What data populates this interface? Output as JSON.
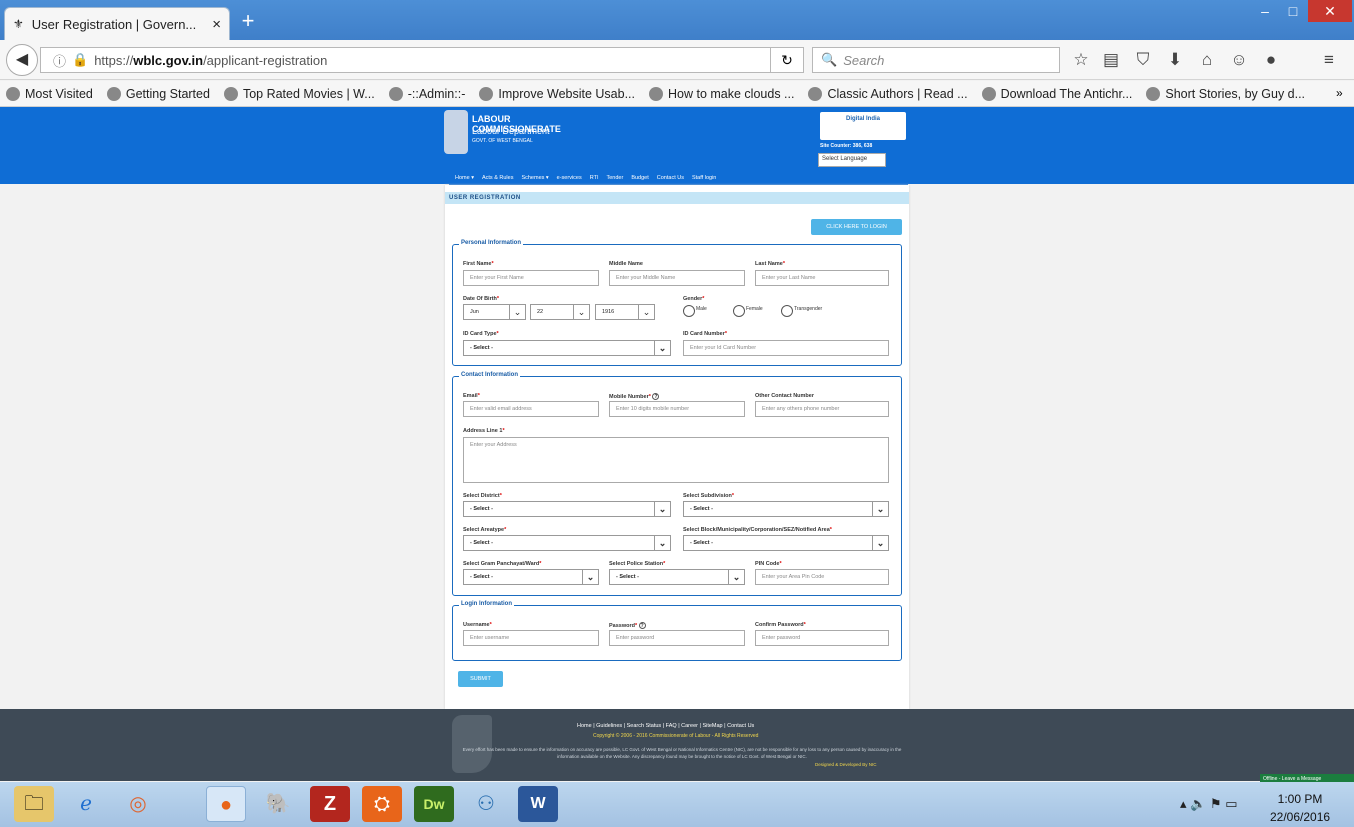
{
  "browser": {
    "tab_title": "User Registration | Govern...",
    "tab_close": "×",
    "new_tab": "+",
    "url_prefix": "https://",
    "url_domain": "wblc.gov.in",
    "url_path": "/applicant-registration",
    "search_placeholder": "Search",
    "bookmarks": [
      "Most Visited",
      "Getting Started",
      "Top Rated Movies | W...",
      "-::Admin::-",
      "Improve Website Usab...",
      "How to make clouds ...",
      "Classic Authors | Read ...",
      "Download The Antichr...",
      "Short Stories, by Guy d..."
    ],
    "overflow": "»"
  },
  "site": {
    "title1": "LABOUR COMMISSIONERATE",
    "title2": "Labour Department",
    "title3": "GOVT. OF WEST BENGAL",
    "digital_india": "Digital India",
    "site_counter": "Site Counter: 386, 638",
    "language_select": "Select Language",
    "menu": [
      "Home ▾",
      "Acts & Rules",
      "Schemes ▾",
      "e-services",
      "RTI",
      "Tender",
      "Budget",
      "Contact Us",
      "Staff login"
    ]
  },
  "form": {
    "page_title": "USER REGISTRATION",
    "login_link": "CLICK HERE TO LOGIN",
    "personal": {
      "legend": "Personal Information",
      "first_name_label": "First Name",
      "first_name_ph": "Enter your First Name",
      "middle_name_label": "Middle Name",
      "middle_name_ph": "Enter your Middle Name",
      "last_name_label": "Last Name",
      "last_name_ph": "Enter your Last Name",
      "dob_label": "Date Of Birth",
      "dob_month": "Jun",
      "dob_day": "22",
      "dob_year": "1916",
      "gender_label": "Gender",
      "gender_options": [
        "Male",
        "Female",
        "Transgender"
      ],
      "idtype_label": "ID Card Type",
      "idtype_value": "- Select -",
      "idnum_label": "ID Card Number",
      "idnum_ph": "Enter your Id Card Number"
    },
    "contact": {
      "legend": "Contact Information",
      "email_label": "Email",
      "email_ph": "Enter valid email address",
      "mobile_label": "Mobile Number",
      "mobile_ph": "Enter 10 digits mobile number",
      "other_label": "Other Contact Number",
      "other_ph": "Enter any others phone number",
      "address_label": "Address Line 1",
      "address_ph": "Enter your Address",
      "district_label": "Select District",
      "subdivision_label": "Select Subdivision",
      "areatype_label": "Select Areatype",
      "block_label": "Select Block/Municipality/Corporation/SEZ/Notified Area",
      "gp_label": "Select Gram Panchayat/Ward",
      "police_label": "Select Police Station",
      "pin_label": "PIN Code",
      "pin_ph": "Enter your Area Pin Code",
      "select_value": "- Select -"
    },
    "login": {
      "legend": "Login Information",
      "username_label": "Username",
      "username_ph": "Enter username",
      "password_label": "Password",
      "password_ph": "Enter password",
      "confirm_label": "Confirm Password",
      "confirm_ph": "Enter password"
    },
    "submit": "SUBMIT",
    "req": "*",
    "help": "?"
  },
  "footer": {
    "links": "Home | Guidelines | Search Status | FAQ | Career | SiteMap | Contact Us",
    "copyright": "Copyright © 2006 - 2016 Commissionerate of Labour - All Rights Reserved",
    "disclaimer": "Every effort has been made to ensure the information on accuracy are possible, LC Govt. of West Bengal or National Informatics Centre (NIC), are not be responsible for any loss to any person caused by inaccuracy in the information available on the Website. Any discrepancy found may be brought to the notice of LC Govt. of West Bengal or NIC.",
    "designed": "Designed & Developed By NIC",
    "offline": "Offline - Leave a Message"
  },
  "taskbar": {
    "time": "1:00 PM",
    "date": "22/06/2016"
  },
  "colors": {
    "header_blue": "#0f6dd5",
    "accent": "#4fb4e7",
    "footer": "#3e4a56"
  }
}
